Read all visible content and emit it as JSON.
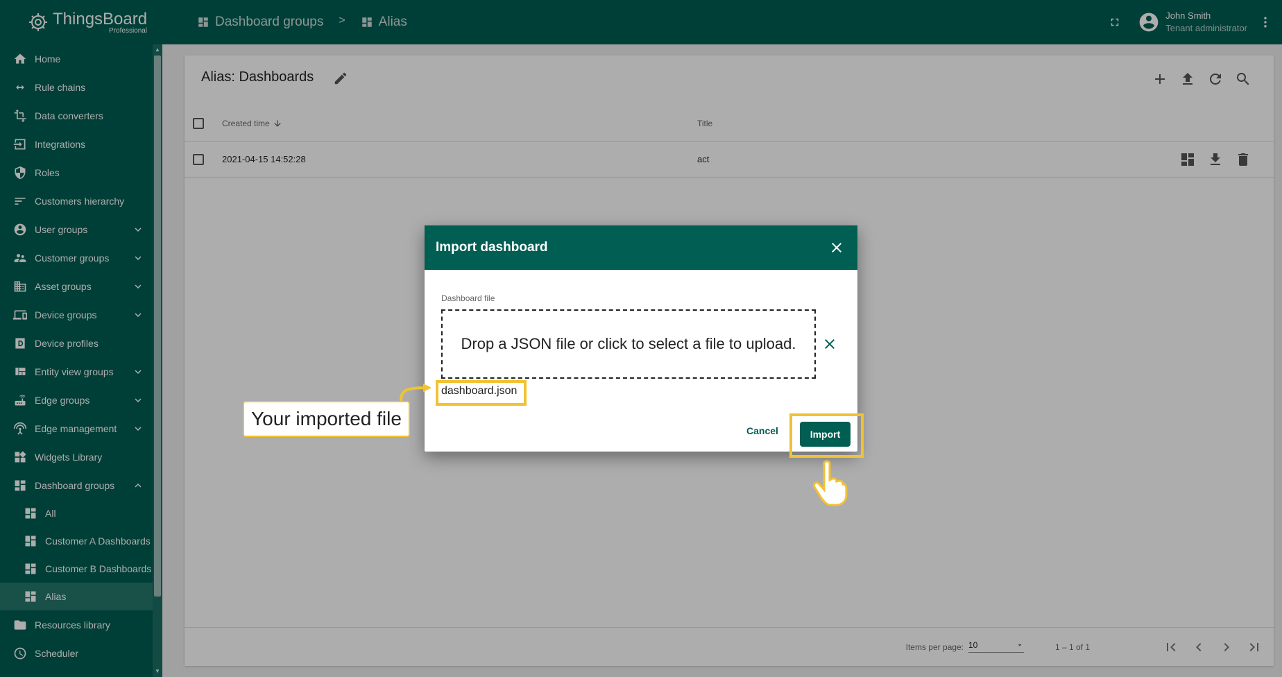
{
  "app": {
    "brand": "ThingsBoard",
    "edition": "Professional"
  },
  "breadcrumb": {
    "items": [
      {
        "label": "Dashboard groups"
      },
      {
        "label": "Alias"
      }
    ],
    "separator": ">"
  },
  "user": {
    "name": "John Smith",
    "role": "Tenant administrator"
  },
  "sidebar": {
    "items": [
      {
        "label": "Home",
        "icon": "home-icon"
      },
      {
        "label": "Rule chains",
        "icon": "rule-chain-icon"
      },
      {
        "label": "Data converters",
        "icon": "transform-icon"
      },
      {
        "label": "Integrations",
        "icon": "input-icon"
      },
      {
        "label": "Roles",
        "icon": "security-icon"
      },
      {
        "label": "Customers hierarchy",
        "icon": "sort-icon"
      },
      {
        "label": "User groups",
        "icon": "account-circle-icon",
        "expandable": true
      },
      {
        "label": "Customer groups",
        "icon": "supervisor-icon",
        "expandable": true
      },
      {
        "label": "Asset groups",
        "icon": "domain-icon",
        "expandable": true
      },
      {
        "label": "Device groups",
        "icon": "devices-icon",
        "expandable": true
      },
      {
        "label": "Device profiles",
        "icon": "device-profile-icon"
      },
      {
        "label": "Entity view groups",
        "icon": "view-quilt-icon",
        "expandable": true
      },
      {
        "label": "Edge groups",
        "icon": "router-icon",
        "expandable": true
      },
      {
        "label": "Edge management",
        "icon": "settings-input-antenna-icon",
        "expandable": true
      },
      {
        "label": "Widgets Library",
        "icon": "widgets-icon"
      },
      {
        "label": "Dashboard groups",
        "icon": "dashboard-icon",
        "expanded": true
      },
      {
        "label": "All",
        "icon": "dashboard-icon",
        "sub": true
      },
      {
        "label": "Customer A Dashboards",
        "icon": "dashboard-icon",
        "sub": true
      },
      {
        "label": "Customer B Dashboards",
        "icon": "dashboard-icon",
        "sub": true
      },
      {
        "label": "Alias",
        "icon": "dashboard-icon",
        "sub": true,
        "active": true
      },
      {
        "label": "Resources library",
        "icon": "folder-icon"
      },
      {
        "label": "Scheduler",
        "icon": "schedule-icon"
      }
    ]
  },
  "main": {
    "title": "Alias: Dashboards",
    "columns": {
      "created": "Created time",
      "title": "Title"
    },
    "rows": [
      {
        "created": "2021-04-15 14:52:28",
        "title": "act"
      }
    ],
    "footer": {
      "items_per_page_label": "Items per page:",
      "items_per_page": "10",
      "range": "1 – 1 of 1"
    }
  },
  "dialog": {
    "title": "Import dashboard",
    "file_label": "Dashboard file",
    "dropzone_text": "Drop a JSON file or click to select a file to upload.",
    "file_name": "dashboard.json",
    "cancel_label": "Cancel",
    "import_label": "Import"
  },
  "callout": {
    "text": "Your imported file"
  },
  "colors": {
    "primary": "#005e52",
    "highlight": "#f1c232"
  }
}
